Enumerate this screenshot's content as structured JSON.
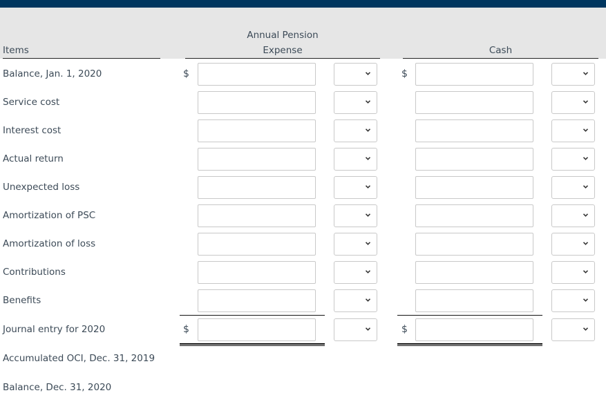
{
  "header": {
    "items_label": "Items",
    "col1_label_line1": "Annual Pension",
    "col1_label_line2": "Expense",
    "col2_label": "Cash"
  },
  "currency_symbol": "$",
  "rows": [
    {
      "label": "Balance, Jan. 1, 2020",
      "col1_value": "",
      "col1_select": "",
      "col2_value": "",
      "col2_select": ""
    },
    {
      "label": "Service cost",
      "col1_value": "",
      "col1_select": "",
      "col2_value": "",
      "col2_select": ""
    },
    {
      "label": "Interest cost",
      "col1_value": "",
      "col1_select": "",
      "col2_value": "",
      "col2_select": ""
    },
    {
      "label": "Actual return",
      "col1_value": "",
      "col1_select": "",
      "col2_value": "",
      "col2_select": ""
    },
    {
      "label": "Unexpected loss",
      "col1_value": "",
      "col1_select": "",
      "col2_value": "",
      "col2_select": ""
    },
    {
      "label": "Amortization of PSC",
      "col1_value": "",
      "col1_select": "",
      "col2_value": "",
      "col2_select": ""
    },
    {
      "label": "Amortization of loss",
      "col1_value": "",
      "col1_select": "",
      "col2_value": "",
      "col2_select": ""
    },
    {
      "label": "Contributions",
      "col1_value": "",
      "col1_select": "",
      "col2_value": "",
      "col2_select": ""
    },
    {
      "label": "Benefits",
      "col1_value": "",
      "col1_select": "",
      "col2_value": "",
      "col2_select": ""
    },
    {
      "label": "Journal entry for 2020",
      "col1_value": "",
      "col1_select": "",
      "col2_value": "",
      "col2_select": ""
    },
    {
      "label": "Accumulated OCI, Dec. 31, 2019"
    },
    {
      "label": "Balance, Dec. 31, 2020"
    }
  ],
  "colors": {
    "top_bar": "#00365f",
    "header_bg": "#e6e6e6",
    "text": "#3c4a57",
    "input_border": "#c8c8c8"
  }
}
